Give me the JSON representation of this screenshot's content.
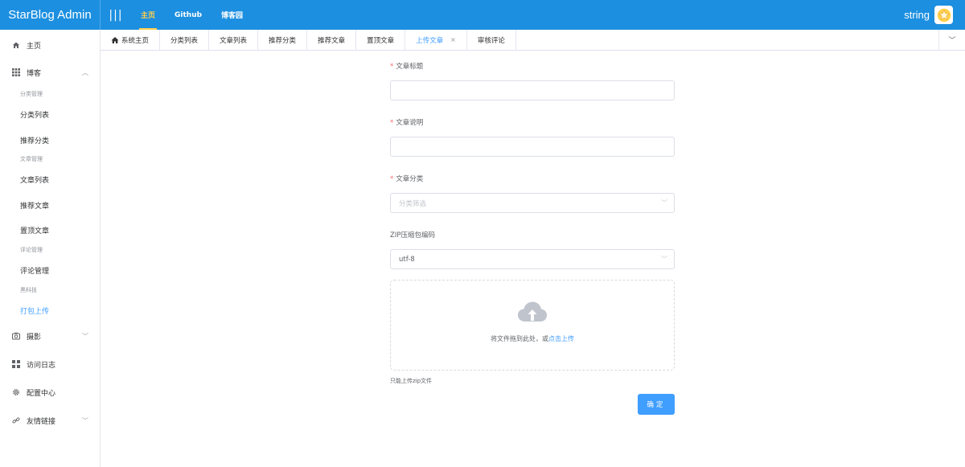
{
  "app": {
    "title": "StarBlog Admin"
  },
  "topnav": {
    "menu_icon": "|||",
    "items": [
      {
        "label": "主页",
        "active": true
      },
      {
        "label": "Github",
        "active": false
      },
      {
        "label": "博客园",
        "active": false
      }
    ]
  },
  "user": {
    "name": "string",
    "avatar_icon": "star-icon"
  },
  "sidebar": {
    "home": "主页",
    "blog": "博客",
    "group_category": "分类管理",
    "category_list": "分类列表",
    "featured_category": "推荐分类",
    "group_post": "文章管理",
    "post_list": "文章列表",
    "featured_post": "推荐文章",
    "top_post": "置顶文章",
    "group_comment": "评论管理",
    "comment_manage": "评论管理",
    "group_tech": "黑科技",
    "pack_upload": "打包上传",
    "photo": "摄影",
    "visit_log": "访问日志",
    "config": "配置中心",
    "links": "友情链接"
  },
  "tabs": {
    "items": [
      {
        "label": "系统主页"
      },
      {
        "label": "分类列表"
      },
      {
        "label": "文章列表"
      },
      {
        "label": "推荐分类"
      },
      {
        "label": "推荐文章"
      },
      {
        "label": "置顶文章"
      },
      {
        "label": "上传文章"
      },
      {
        "label": "审核评论"
      }
    ],
    "close": "×"
  },
  "form": {
    "title_label": "文章标题",
    "desc_label": "文章说明",
    "category_label": "文章分类",
    "category_placeholder": "分类筛选",
    "encoding_label": "ZIP压缩包编码",
    "encoding_value": "utf-8",
    "required_mark": "*",
    "upload_text": "将文件拖到此处，或",
    "upload_link": "点击上传",
    "tip": "只能上传zip文件",
    "submit": "确定"
  },
  "colors": {
    "topbar": "#1c8fe0",
    "accent": "#409eff",
    "active_topnav": "#ffd04b"
  }
}
